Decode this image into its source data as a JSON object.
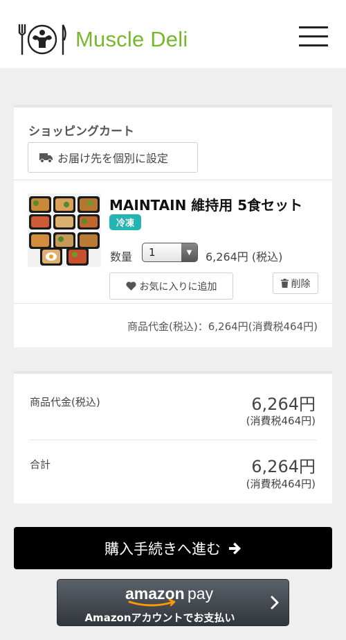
{
  "header": {
    "logo_text": "Muscle Deli",
    "brand_color": "#76b82a"
  },
  "cart": {
    "title": "ショッピングカート",
    "ship_button": "お届け先を個別に設定",
    "item": {
      "name": "MAINTAIN 維持用 5食セット",
      "badge": "冷凍",
      "badge_color": "#24b4b2",
      "qty_label": "数量",
      "qty_value": "1",
      "price": "6,264円 (税込)",
      "favorite_button": "お気に入りに追加",
      "delete_button": "削除"
    },
    "subtotal": "商品代金(税込)：6,264円(消費税464円)"
  },
  "totals": {
    "items_label": "商品代金(税込)",
    "items_amount": "6,264円",
    "items_tax": "(消費税464円)",
    "total_label": "合計",
    "total_amount": "6,264円",
    "total_tax": "(消費税464円)"
  },
  "checkout": {
    "button_label": "購入手続きへ進む"
  },
  "amazon_pay": {
    "logo_text_1": "amazon",
    "logo_text_2": "pay",
    "sub_label": "Amazonアカウントでお支払い"
  }
}
